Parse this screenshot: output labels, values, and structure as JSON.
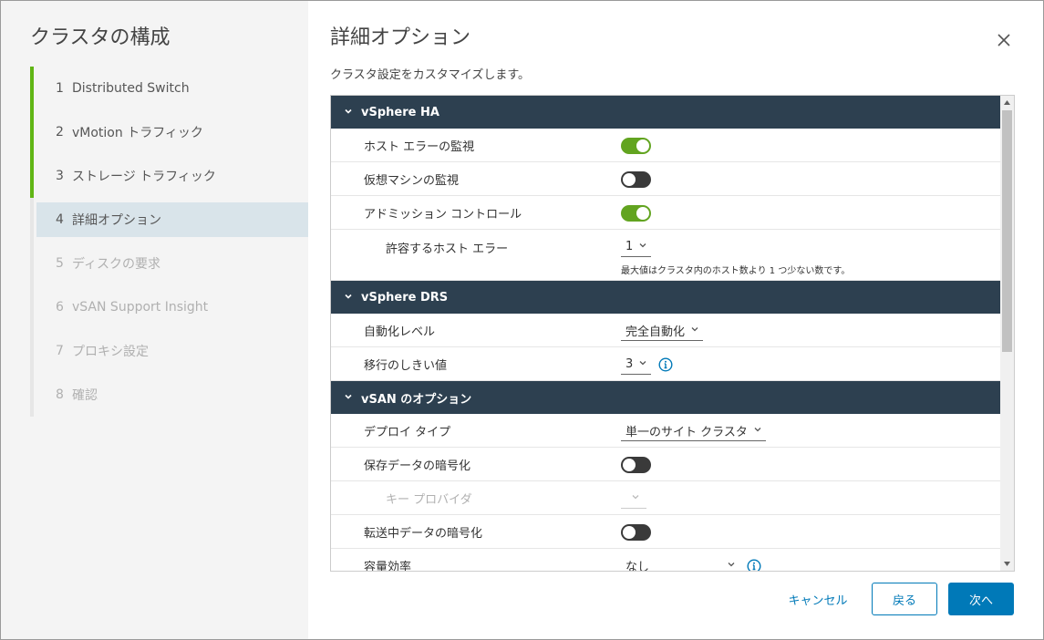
{
  "left": {
    "title": "クラスタの構成",
    "steps": [
      {
        "num": "1",
        "label": "Distributed Switch"
      },
      {
        "num": "2",
        "label": "vMotion トラフィック"
      },
      {
        "num": "3",
        "label": "ストレージ トラフィック"
      },
      {
        "num": "4",
        "label": "詳細オプション"
      },
      {
        "num": "5",
        "label": "ディスクの要求"
      },
      {
        "num": "6",
        "label": "vSAN Support Insight"
      },
      {
        "num": "7",
        "label": "プロキシ設定"
      },
      {
        "num": "8",
        "label": "確認"
      }
    ]
  },
  "main": {
    "title": "詳細オプション",
    "subtitle": "クラスタ設定をカスタマイズします。",
    "ha": {
      "header": "vSphere HA",
      "host_monitoring": {
        "label": "ホスト エラーの監視",
        "state": "on"
      },
      "vm_monitoring": {
        "label": "仮想マシンの監視",
        "state": "off"
      },
      "admission_control": {
        "label": "アドミッション コントロール",
        "state": "on"
      },
      "host_failures": {
        "label": "許容するホスト エラー",
        "value": "1",
        "hint": "最大値はクラスタ内のホスト数より 1 つ少ない数です。"
      }
    },
    "drs": {
      "header": "vSphere DRS",
      "automation": {
        "label": "自動化レベル",
        "value": "完全自動化"
      },
      "threshold": {
        "label": "移行のしきい値",
        "value": "3"
      }
    },
    "vsan": {
      "header": "vSAN のオプション",
      "deploy_type": {
        "label": "デプロイ タイプ",
        "value": "単一のサイト クラスタ"
      },
      "encryption_rest": {
        "label": "保存データの暗号化",
        "state": "off"
      },
      "key_provider": {
        "label": "キー プロバイダ",
        "value": ""
      },
      "encryption_transit": {
        "label": "転送中データの暗号化",
        "state": "off"
      },
      "space_efficiency": {
        "label": "容量効率",
        "value": "なし"
      }
    }
  },
  "footer": {
    "cancel": "キャンセル",
    "back": "戻る",
    "next": "次へ"
  },
  "colors": {
    "header_bg": "#2d4050",
    "toggle_on": "#62a420",
    "toggle_off": "#3a3a3a",
    "primary": "#0079b8",
    "step_done": "#60b515",
    "step_active_bg": "#d9e4ea"
  }
}
